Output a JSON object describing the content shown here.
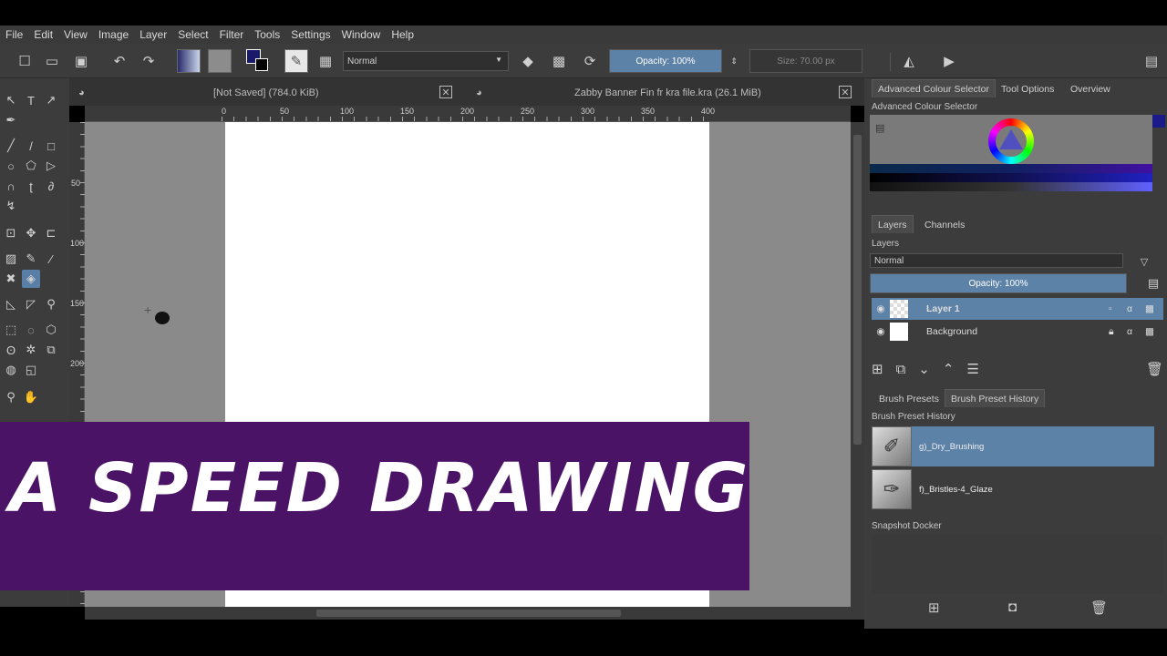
{
  "menu": [
    "File",
    "Edit",
    "View",
    "Image",
    "Layer",
    "Select",
    "Filter",
    "Tools",
    "Settings",
    "Window",
    "Help"
  ],
  "toolbar": {
    "blend_mode": "Normal",
    "opacity": "Opacity: 100%",
    "size_label": "Size:",
    "size_value": "70.00 px"
  },
  "documents": [
    {
      "name": "[Not Saved]",
      "size": "(784.0 KiB)"
    },
    {
      "name": "Zabby Banner Fin fr kra file.kra",
      "size": "(26.1 MiB)"
    }
  ],
  "ruler_h": [
    "0",
    "50",
    "100",
    "150",
    "200",
    "250",
    "300",
    "350",
    "400"
  ],
  "ruler_v": [
    "50",
    "100",
    "150",
    "200"
  ],
  "banner": {
    "text": "A SPEED DRAWING",
    "color": "#4a1366"
  },
  "dock": {
    "top_tabs": [
      "Advanced Colour Selector",
      "Tool Options",
      "Overview"
    ],
    "colour_title": "Advanced Colour Selector",
    "layer_tabs": [
      "Layers",
      "Channels"
    ],
    "layers_title": "Layers",
    "layer_blend": "Normal",
    "layer_opacity": "Opacity:  100%",
    "layers": [
      {
        "name": "Layer 1",
        "selected": true
      },
      {
        "name": "Background",
        "selected": false
      }
    ],
    "brush_tabs": [
      "Brush Presets",
      "Brush Preset History"
    ],
    "brush_title": "Brush Preset History",
    "presets": [
      {
        "name": "g)_Dry_Brushing",
        "selected": true
      },
      {
        "name": "f)_Bristles-4_Glaze",
        "selected": false
      }
    ],
    "snapshot_title": "Snapshot Docker"
  },
  "colors": {
    "accent": "#5d82a8",
    "panel": "#3c3c3c",
    "canvas_bg": "#8a8a8a"
  }
}
